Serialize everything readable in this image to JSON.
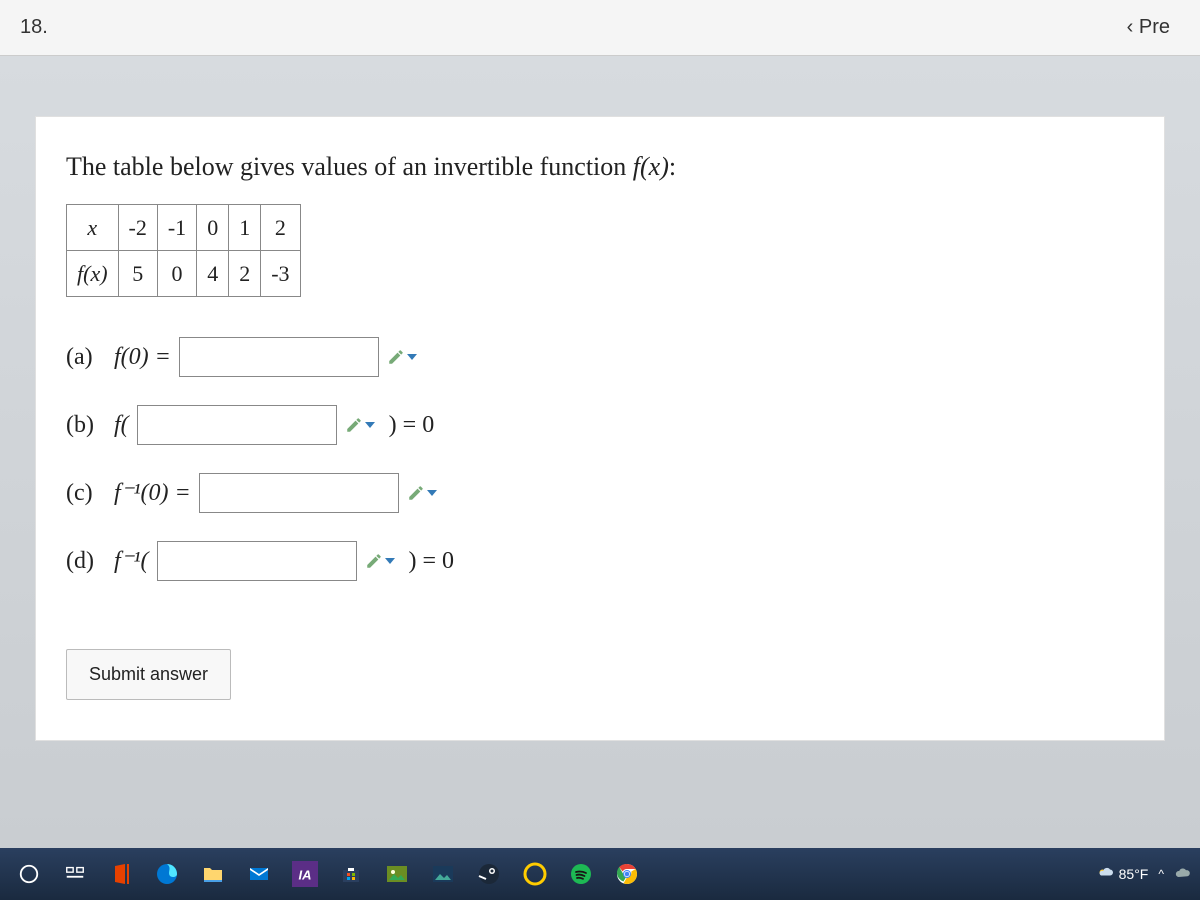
{
  "header": {
    "question_number": "18.",
    "prev_label": "‹ Pre"
  },
  "question": {
    "prompt_prefix": "The table below gives values of an invertible function ",
    "prompt_fx": "f(x)",
    "prompt_suffix": ":"
  },
  "table": {
    "x_label": "x",
    "fx_label": "f(x)",
    "x_values": [
      "-2",
      "-1",
      "0",
      "1",
      "2"
    ],
    "fx_values": [
      "5",
      "0",
      "4",
      "2",
      "-3"
    ]
  },
  "parts": {
    "a": {
      "label": "(a)",
      "expr": "f(0) ="
    },
    "b": {
      "label": "(b)",
      "expr_pre": "f(",
      "expr_post": ") = 0"
    },
    "c": {
      "label": "(c)",
      "expr": "f⁻¹(0) ="
    },
    "d": {
      "label": "(d)",
      "expr_pre": "f⁻¹(",
      "expr_post": ") = 0"
    }
  },
  "submit_label": "Submit answer",
  "taskbar": {
    "icons": {
      "start": "start-icon",
      "search": "cortana-circle-icon",
      "taskview": "task-view-icon",
      "office": "office-icon",
      "edge": "edge-icon",
      "explorer": "file-explorer-icon",
      "mail": "mail-icon",
      "ia": "ia-app-icon",
      "store": "store-icon",
      "picture1": "picture-app-icon",
      "picture2": "picture-app2-icon",
      "steam": "steam-icon",
      "circle": "norton-icon",
      "spotify": "spotify-icon",
      "chrome": "chrome-icon"
    },
    "weather_temp": "85°F",
    "tray": {
      "chevron": "^"
    }
  }
}
